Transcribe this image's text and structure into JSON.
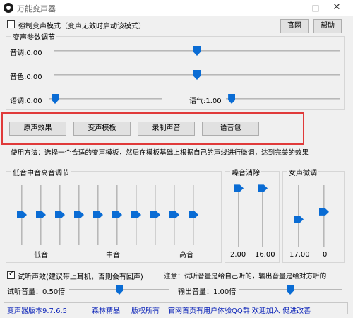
{
  "window": {
    "title": "万能变声器",
    "close_glyph": "✕",
    "min_glyph": "—",
    "max_glyph": "□"
  },
  "top": {
    "strong_mode_label": "强制变声模式（变声无效时启动该模式）",
    "strong_mode_checked": false,
    "official_site_label": "官网",
    "help_label": "帮助"
  },
  "params_group": {
    "title": "变声参数调节",
    "pitch_label": "音调:0.00",
    "pitch_value": 0.5,
    "timbre_label": "音色:0.00",
    "timbre_value": 0.5,
    "speed_label": "语调:0.00",
    "speed_value": 0.05,
    "tone_label": "语气:1.00",
    "tone_value": 0.05
  },
  "actions": {
    "original_label": "原声效果",
    "template_label": "变声模板",
    "record_label": "录制声音",
    "voicepack_label": "语音包"
  },
  "usage_text": "使用方法：选择一个合适的变声模板，然后在模板基础上根据自己的声线进行微调，达到完美的效果",
  "eq_group": {
    "title": "低音中音高音调节",
    "low_label": "低音",
    "mid_label": "中音",
    "high_label": "高音",
    "bands": [
      0.5,
      0.5,
      0.5,
      0.5,
      0.5,
      0.5,
      0.5,
      0.5,
      0.5,
      0.5
    ]
  },
  "noise_group": {
    "title": "噪音消除",
    "left_value_label": "2.00",
    "right_value_label": "16.00",
    "left_value": 0.05,
    "right_value": 0.05
  },
  "female_group": {
    "title": "女声微调",
    "left_value_label": "17.00",
    "right_value_label": "0",
    "left_value": 0.55,
    "right_value": 0.43
  },
  "monitor": {
    "checkbox_label": "试听声效(建议带上耳机，否则会有回声)",
    "checked": true,
    "note": "注意：试听音量是给自己听的，输出音量是给对方听的",
    "listen_volume_label": "试听音量：0.50倍",
    "listen_volume_value": 0.5,
    "output_volume_label": "输出音量：1.00倍",
    "output_volume_value": 0.5
  },
  "footer": {
    "version": "变声器版本9.7.6.5",
    "brand": "森林精品",
    "rights": "版权所有",
    "promo": "官网首页有用户体验QQ群 欢迎加入 促进改善"
  }
}
